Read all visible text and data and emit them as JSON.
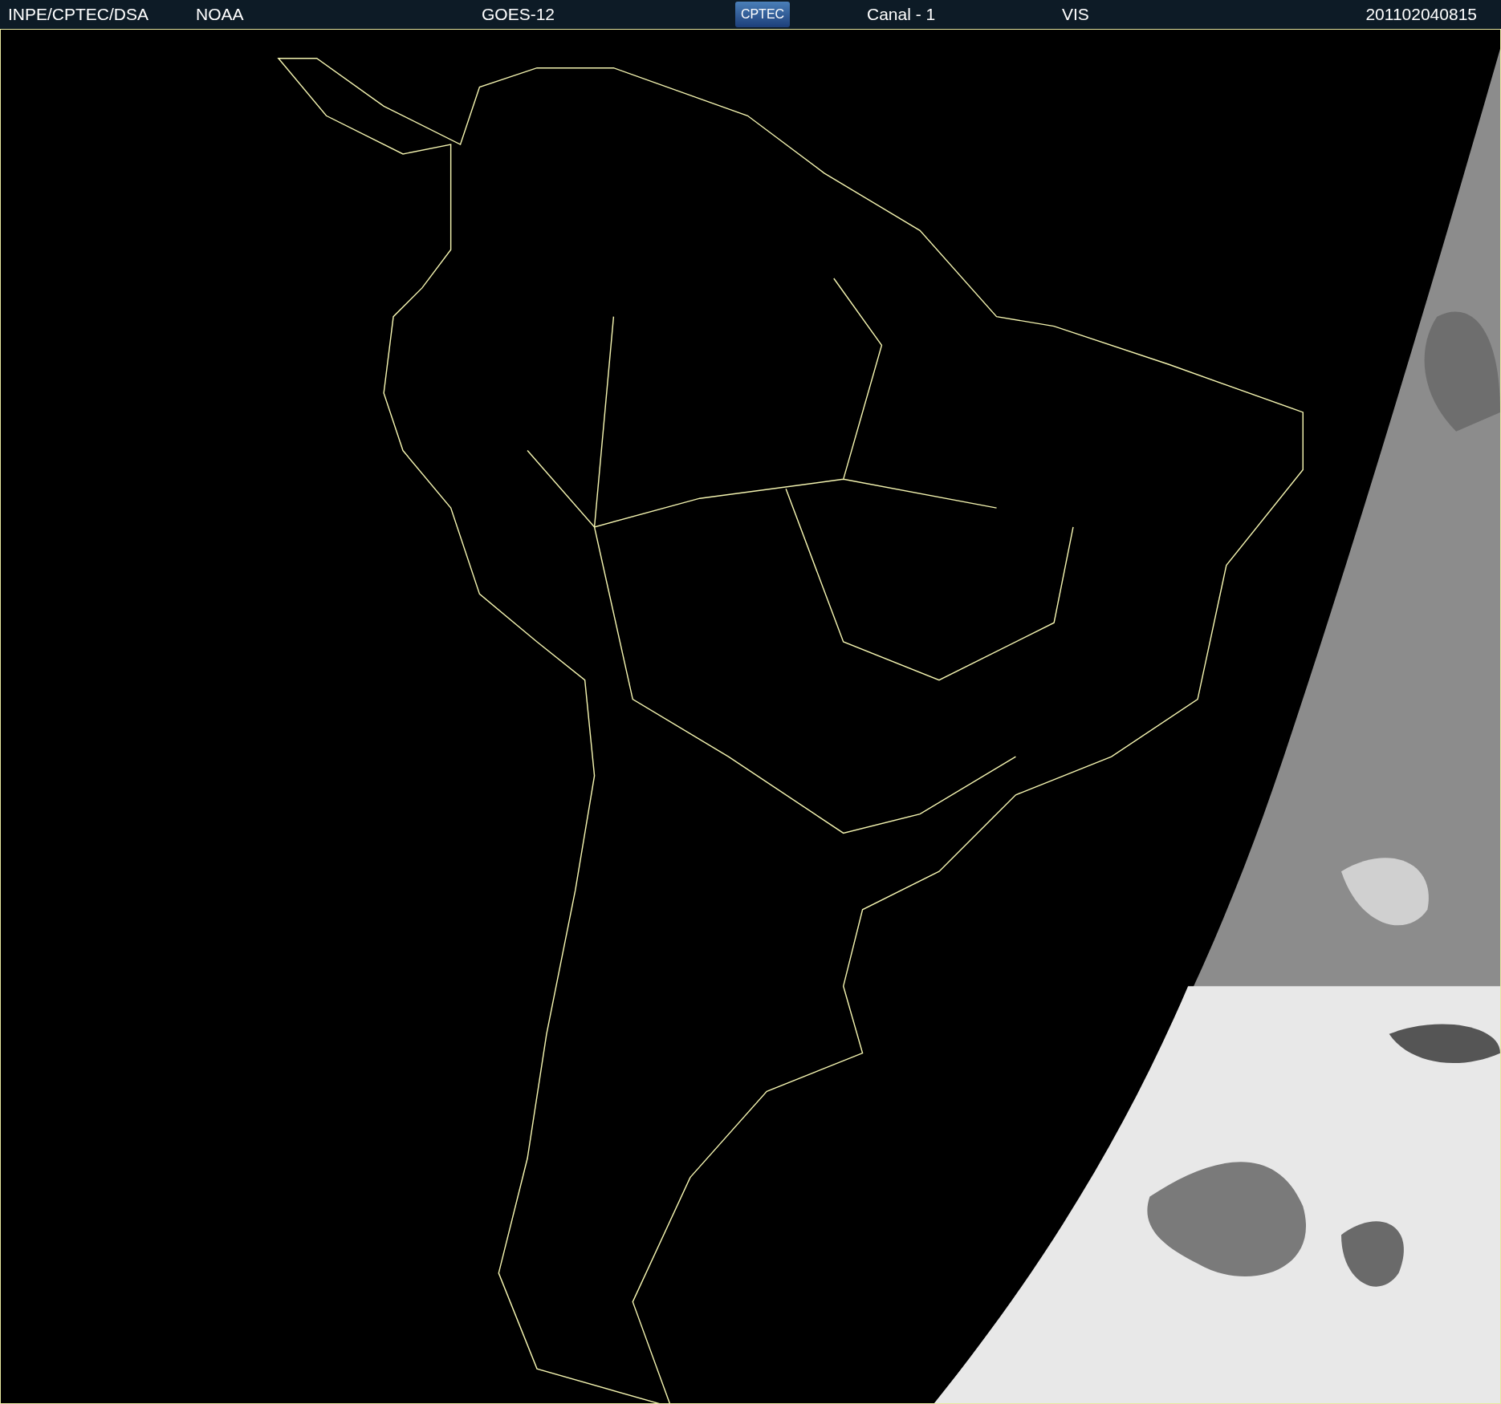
{
  "header": {
    "items": [
      {
        "kind": "text",
        "text": "INPE/CPTEC/DSA"
      },
      {
        "kind": "text",
        "text": "NOAA"
      },
      {
        "kind": "text",
        "text": "GOES-12"
      },
      {
        "kind": "logo",
        "text": "CPTEC"
      },
      {
        "kind": "text",
        "text": "Canal - 1"
      },
      {
        "kind": "text",
        "text": "VIS"
      },
      {
        "kind": "text",
        "text": "201102040815"
      }
    ]
  }
}
